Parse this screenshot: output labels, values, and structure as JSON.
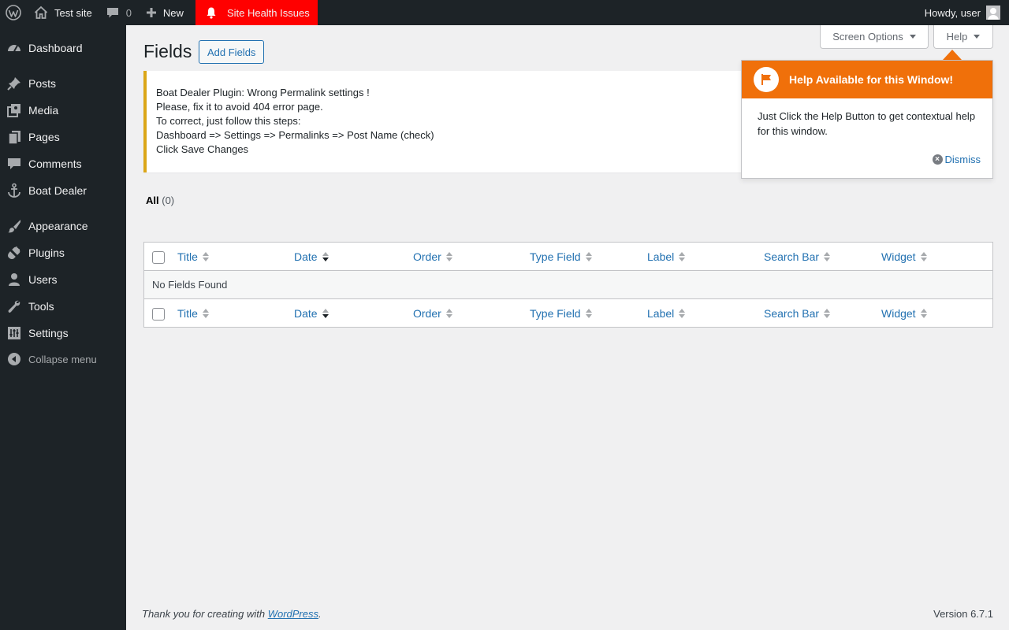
{
  "admin_bar": {
    "site_name": "Test site",
    "comments_count": "0",
    "new_label": "New",
    "health_label": "Site Health Issues",
    "greeting": "Howdy, user"
  },
  "sidebar": {
    "items": [
      {
        "label": "Dashboard",
        "icon": "dashboard-icon"
      },
      {
        "label": "Posts",
        "icon": "pin-icon"
      },
      {
        "label": "Media",
        "icon": "media-icon"
      },
      {
        "label": "Pages",
        "icon": "pages-icon"
      },
      {
        "label": "Comments",
        "icon": "comment-icon"
      },
      {
        "label": "Boat Dealer",
        "icon": "anchor-icon"
      },
      {
        "label": "Appearance",
        "icon": "brush-icon"
      },
      {
        "label": "Plugins",
        "icon": "plug-icon"
      },
      {
        "label": "Users",
        "icon": "user-icon"
      },
      {
        "label": "Tools",
        "icon": "wrench-icon"
      },
      {
        "label": "Settings",
        "icon": "sliders-icon"
      }
    ],
    "collapse_label": "Collapse menu"
  },
  "page": {
    "title": "Fields",
    "add_button": "Add Fields",
    "screen_options": "Screen Options",
    "help": "Help"
  },
  "notice": {
    "lines": [
      "Boat Dealer Plugin: Wrong Permalink settings !",
      "Please, fix it to avoid 404 error page.",
      "To correct, just follow this steps:",
      "Dashboard => Settings => Permalinks => Post Name (check)",
      "Click Save Changes"
    ]
  },
  "pointer": {
    "title": "Help Available for this Window!",
    "body": "Just Click the Help Button to get contextual help for this window.",
    "dismiss": "Dismiss"
  },
  "filters": {
    "all_label": "All",
    "all_count": "(0)"
  },
  "table": {
    "columns": [
      "Title",
      "Date",
      "Order",
      "Type Field",
      "Label",
      "Search Bar",
      "Widget"
    ],
    "empty_message": "No Fields Found"
  },
  "footer": {
    "thanks_prefix": "Thank you for creating with ",
    "thanks_link": "WordPress",
    "thanks_suffix": ".",
    "version": "Version 6.7.1"
  },
  "colors": {
    "admin_bg": "#1d2327",
    "accent": "#2271b1",
    "health_red": "#ff0000",
    "pointer_orange": "#f0700a",
    "notice_border": "#dba617"
  }
}
